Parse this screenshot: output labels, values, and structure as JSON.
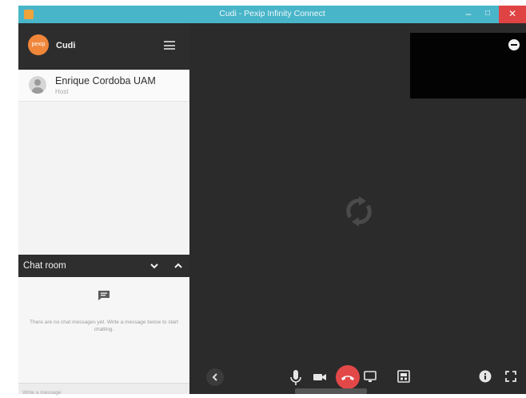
{
  "window": {
    "title": "Cudi - Pexip Infinity Connect",
    "minimize_glyph": "–",
    "maximize_glyph": "□",
    "close_glyph": "✕"
  },
  "sidebar": {
    "logo_text": "pexip",
    "conference_name": "Cudi",
    "participants": [
      {
        "name": "Enrique Cordoba UAM",
        "role": "Host"
      }
    ]
  },
  "chat": {
    "title": "Chat room",
    "empty_message": "There are no chat messages yet. Write a message below to start chatting.",
    "input_placeholder": "Write a message"
  },
  "icons": {
    "app": "app-icon",
    "menu": "hamburger-menu-icon",
    "collapse": "chevron-down-icon",
    "expand": "chevron-up-icon",
    "chat": "chat-bubble-icon",
    "loading": "refresh-icon",
    "selfview_hide": "minus-circle-icon",
    "back": "chevron-left-icon",
    "mic": "microphone-icon",
    "camera": "camera-icon",
    "hangup": "phone-hangup-icon",
    "share": "screen-share-icon",
    "layout": "layout-icon",
    "info": "info-icon",
    "fullscreen": "fullscreen-icon"
  },
  "colors": {
    "titlebar": "#49b5c9",
    "logo": "#f0863a",
    "hangup": "#e34848",
    "close": "#e04343"
  }
}
